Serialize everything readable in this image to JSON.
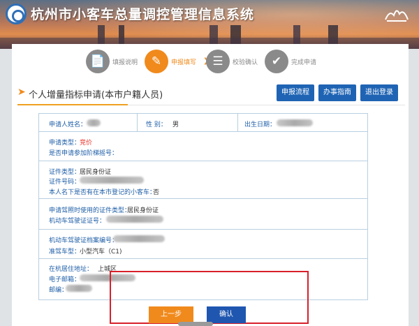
{
  "header": {
    "system_title": "杭州市小客车总量调控管理信息系统"
  },
  "steps": [
    {
      "label": "填报说明",
      "icon": "document-icon",
      "active": false
    },
    {
      "label": "申报填写",
      "icon": "edit-icon",
      "active": true
    },
    {
      "label": "校验确认",
      "icon": "chat-icon",
      "active": false
    },
    {
      "label": "完成申请",
      "icon": "check-icon",
      "active": false
    }
  ],
  "section": {
    "title": "个人增量指标申请(本市户籍人员)",
    "buttons": {
      "process": "申报流程",
      "guide": "办事指南",
      "logout": "退出登录"
    }
  },
  "form": {
    "applicant_name_label": "申请人姓名：",
    "gender_label": "性 别：",
    "gender_value": "男",
    "birth_label": "出生日期：",
    "apply_type_label": "申请类型：",
    "apply_type_value": "竞价",
    "ladder_label": "是否申请参加阶梯摇号：",
    "id_type_label": "证件类型：",
    "id_type_value": "居民身份证",
    "id_no_label": "证件号码：",
    "car_registered_label": "本人名下是否有在本市登记的小客车：",
    "car_registered_value": "否",
    "license_id_type_label": "申请驾照时使用的证件类型：",
    "license_id_type_value": "居民身份证",
    "license_no_label": "机动车驾驶证证号：",
    "archive_no_label": "机动车驾驶证档案编号：",
    "vehicle_class_label": "准驾车型：",
    "vehicle_class_value": "小型汽车（C1)",
    "district_label": "在杭居住地址：",
    "district_value": "上城区",
    "email_label": "电子邮箱：",
    "postcode_label": "邮编："
  },
  "actions": {
    "prev": "上一步",
    "confirm": "确认"
  },
  "colors": {
    "accent_orange": "#f08a1c",
    "brand_blue": "#1f64b4",
    "label_blue": "#1e5ea7",
    "highlight_red": "#d7202a"
  }
}
